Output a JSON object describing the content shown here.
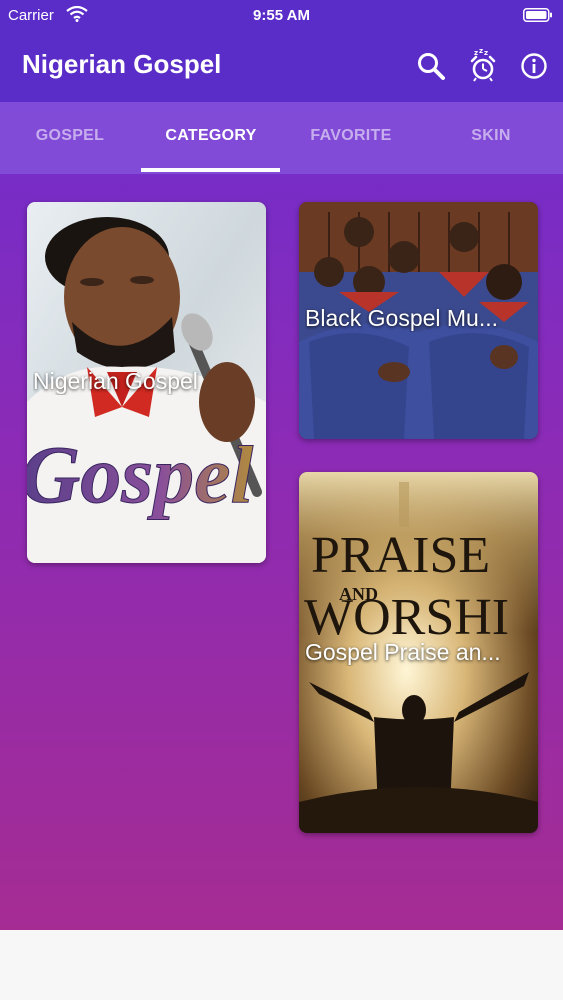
{
  "status_bar": {
    "carrier": "Carrier",
    "time": "9:55 AM"
  },
  "app_bar": {
    "title": "Nigerian Gospel",
    "icons": [
      "search-icon",
      "sleep-timer-alarm-icon",
      "info-icon"
    ]
  },
  "tabs": [
    {
      "label": "GOSPEL",
      "active": false
    },
    {
      "label": "CATEGORY",
      "active": true
    },
    {
      "label": "FAVORITE",
      "active": false
    },
    {
      "label": "SKIN",
      "active": false
    }
  ],
  "categories": [
    {
      "label": "Nigerian Gospel",
      "artwork_text": "Gospel"
    },
    {
      "label": "Black Gospel Mu..."
    },
    {
      "label": "Gospel Praise an...",
      "artwork_text": {
        "line1": "PRAISE",
        "line2": "AND",
        "line3": "WORSHI"
      }
    }
  ],
  "colors": {
    "primary": "#5a2cc8",
    "gradient_end": "#a52c93",
    "tab_bar": "#8656dc"
  }
}
